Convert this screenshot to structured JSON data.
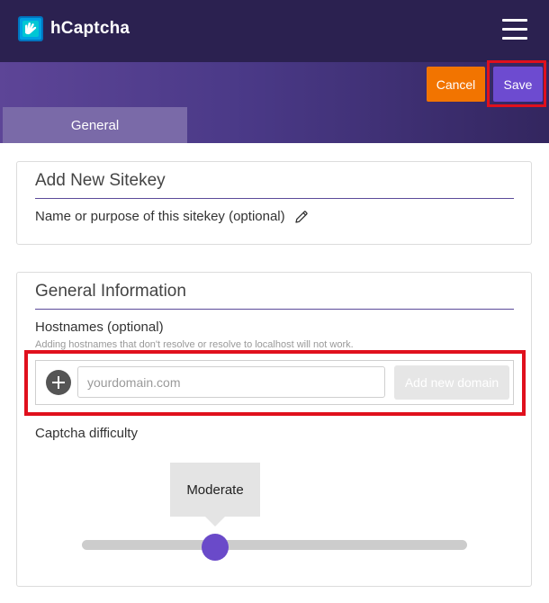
{
  "header": {
    "brand": "hCaptcha",
    "logo_icon": "hcaptcha-logo-icon",
    "menu_icon": "hamburger-menu-icon"
  },
  "actions": {
    "cancel_label": "Cancel",
    "save_label": "Save"
  },
  "tabs": [
    {
      "label": "General",
      "active": true
    }
  ],
  "sitekey": {
    "title": "Add New Sitekey",
    "name_placeholder": "Name or purpose of this sitekey (optional)",
    "edit_icon": "pencil-icon"
  },
  "general": {
    "title": "General Information",
    "hostnames_label": "Hostnames (optional)",
    "hostnames_hint": "Adding hostnames that don't resolve or resolve to localhost will not work.",
    "domain_placeholder": "yourdomain.com",
    "domain_value": "",
    "add_domain_label": "Add new domain",
    "add_icon": "plus-circle-icon",
    "difficulty_label": "Captcha difficulty",
    "difficulty_value": "Moderate",
    "difficulty_level": 0.345
  },
  "colors": {
    "header_bg": "#2b2150",
    "cancel": "#f27400",
    "save": "#6d4bd0",
    "highlight": "#e0101d",
    "slider_thumb": "#6a4ac9"
  }
}
